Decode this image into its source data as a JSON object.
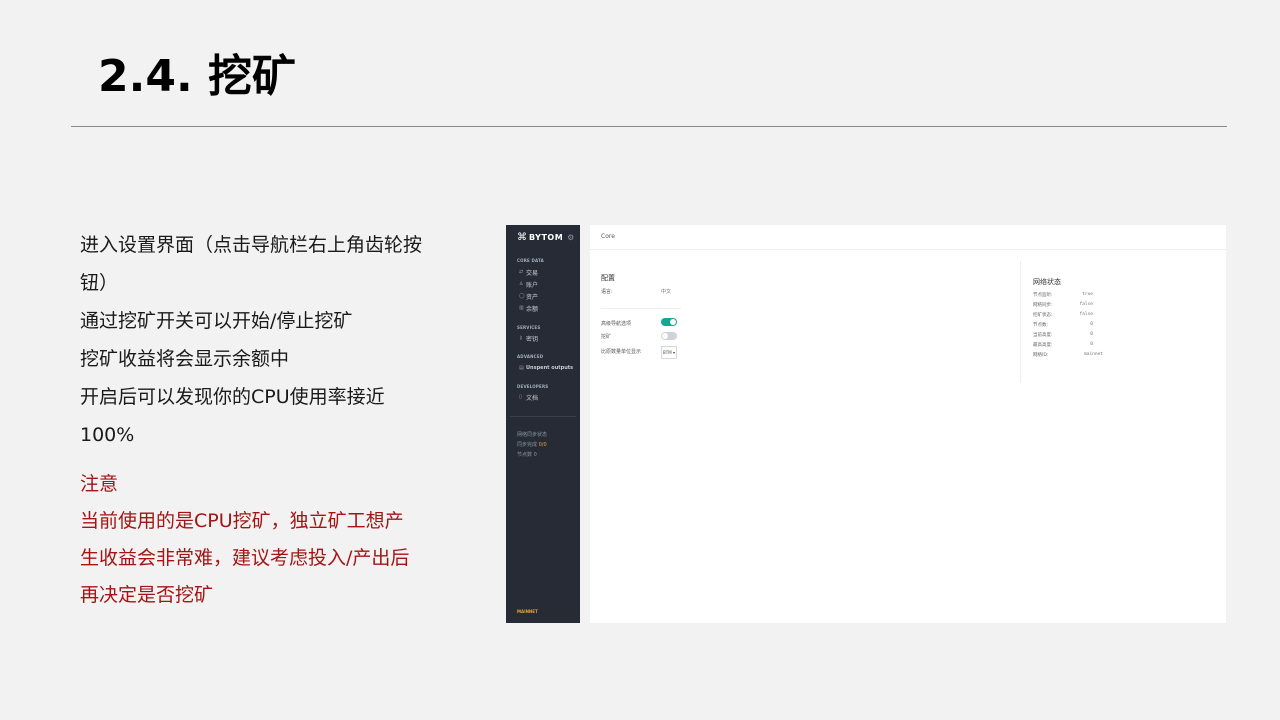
{
  "slide": {
    "title": "2.4. 挖矿",
    "body_lines": [
      "进入设置界面（点击导航栏右上角齿轮按",
      "钮）",
      "通过挖矿开关可以开始/停止挖矿",
      "挖矿收益将会显示余额中",
      "开启后可以发现你的CPU使用率接近",
      "100%"
    ],
    "note_lines": [
      "注意",
      "当前使用的是CPU挖矿，独立矿工想产",
      "生收益会非常难，建议考虑投入/产出后",
      "再决定是否挖矿"
    ],
    "note_color": "#a31515"
  },
  "app": {
    "logo_text": "BYTOM",
    "logo_icon": "bytom-logo-icon",
    "settings_icon": "gear-icon",
    "sections": {
      "core_data": "CORE DATA",
      "services": "SERVICES",
      "advanced": "ADVANCED",
      "developers": "DEVELOPERS"
    },
    "nav": {
      "transactions": "交易",
      "accounts": "账户",
      "assets": "资产",
      "balances": "余额",
      "keys": "密钥",
      "unspent": "Unspent outputs",
      "docs": "文档"
    },
    "sync": {
      "title": "网络同步状态",
      "progress_label": "同步完成",
      "progress_value": "0/0",
      "peers_label": "节点数",
      "peers_value": "0"
    },
    "network_badge": "MAINNET",
    "accent_color": "#1aa592",
    "main": {
      "header": "Core",
      "config_title": "配置",
      "language_label": "语言:",
      "language_value": "中文",
      "advanced_nav_label": "高级导航选项",
      "advanced_nav_on": true,
      "mining_label": "挖矿",
      "mining_on": false,
      "unit_label": "比原数量单位显示",
      "unit_value": "BTM ▾"
    },
    "status": {
      "title": "网络状态",
      "rows": [
        {
          "key": "节点监听:",
          "value": "true"
        },
        {
          "key": "网络同步:",
          "value": "false"
        },
        {
          "key": "挖矿状态:",
          "value": "false"
        },
        {
          "key": "节点数:",
          "value": "0"
        },
        {
          "key": "当前高度:",
          "value": "0"
        },
        {
          "key": "最高高度:",
          "value": "0"
        },
        {
          "key": "网络ID:",
          "value": "mainnet"
        }
      ]
    }
  }
}
